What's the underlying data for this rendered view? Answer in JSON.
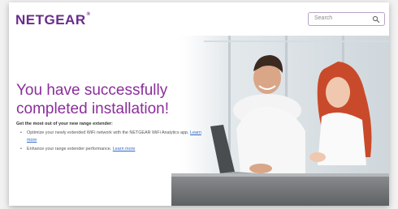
{
  "brand": {
    "logo_text": "NETGEAR",
    "logo_mark": "®",
    "color": "#6a2c8c"
  },
  "search": {
    "placeholder": "Search",
    "icon": "search-icon"
  },
  "hero": {
    "headline_line1": "You have successfully",
    "headline_line2": "completed installation!",
    "headline_color": "#8b2e9b",
    "subhead": "Get the most out of your new range extender:",
    "bullets": [
      {
        "text": "Optimize your newly extended WiFi network with the NETGEAR WiFi Analytics app.",
        "link": "Learn more"
      },
      {
        "text": "Enhance your range extender performance.",
        "link": "Learn more"
      }
    ],
    "link_color": "#2f69c7"
  }
}
